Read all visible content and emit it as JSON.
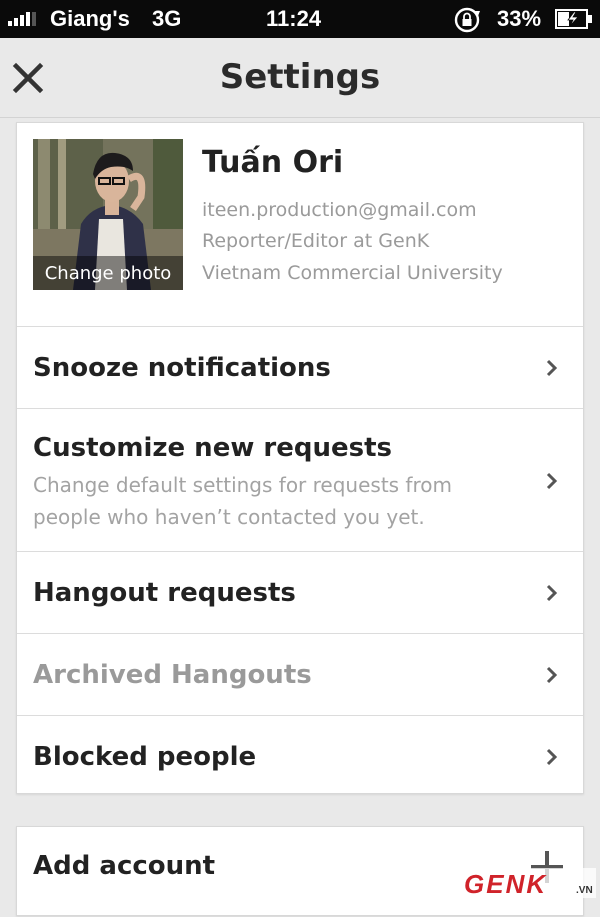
{
  "status_bar": {
    "carrier": "Giang's",
    "network": "3G",
    "time": "11:24",
    "battery": "33%",
    "signal_icon": "signal-bars-icon",
    "lock_icon": "rotation-lock-icon",
    "battery_icon": "battery-charging-icon"
  },
  "header": {
    "title": "Settings",
    "close_icon": "close-icon"
  },
  "profile": {
    "name": "Tuấn Ori",
    "email": "iteen.production@gmail.com",
    "job": "Reporter/Editor at GenK",
    "school": "Vietnam Commercial University",
    "change_photo_label": "Change photo"
  },
  "settings": {
    "items": [
      {
        "label": "Snooze notifications"
      },
      {
        "label": "Customize new requests",
        "description": "Change default settings for requests from people who haven’t contacted you yet."
      },
      {
        "label": "Hangout requests"
      },
      {
        "label": "Archived Hangouts"
      },
      {
        "label": "Blocked people"
      }
    ]
  },
  "account": {
    "add_label": "Add account"
  },
  "watermark": {
    "text": "GENK",
    "suffix": ".VN"
  },
  "colors": {
    "background": "#e9e9e9",
    "status_bar": "#0a0a0a",
    "card": "#ffffff",
    "primary_text": "#222222",
    "secondary_text": "#9a9a9a",
    "watermark_red": "#d0232a"
  }
}
